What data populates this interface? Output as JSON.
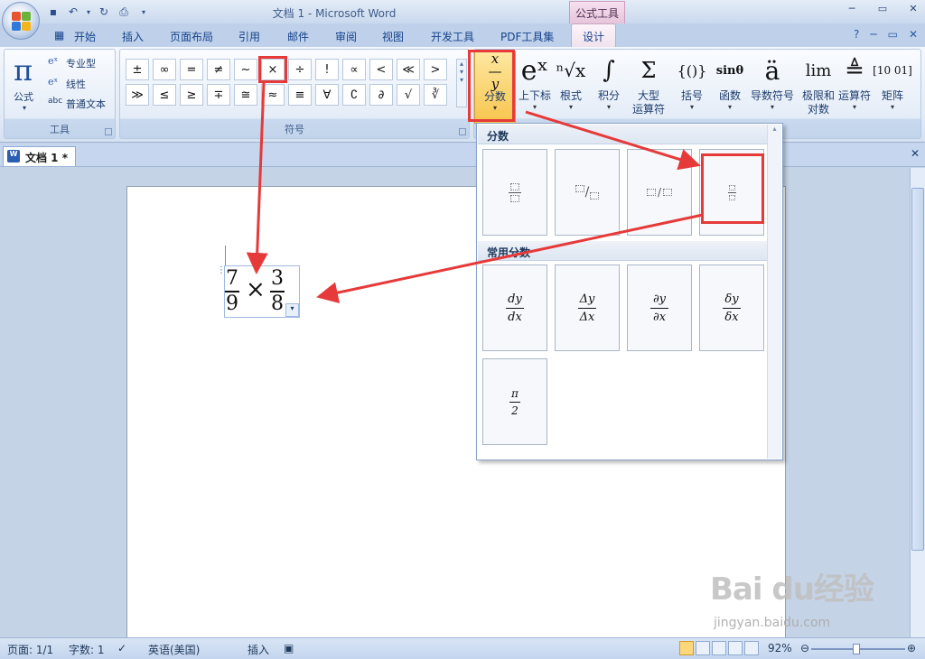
{
  "window": {
    "title": "文档 1 - Microsoft Word",
    "contextual_tab_group": "公式工具"
  },
  "tabs": [
    "开始",
    "插入",
    "页面布局",
    "引用",
    "邮件",
    "审阅",
    "视图",
    "开发工具",
    "PDF工具集",
    "设计"
  ],
  "ribbon": {
    "tools_group": {
      "label": "工具",
      "formula": "公式",
      "professional": "专业型",
      "linear": "线性",
      "normal_text": "普通文本",
      "normal_text_prefix": "abc"
    },
    "symbols_group": {
      "label": "符号",
      "row1": [
        "±",
        "∞",
        "=",
        "≠",
        "~",
        "×",
        "÷",
        "!",
        "∝",
        "<",
        "≪",
        ">"
      ],
      "row2": [
        "≫",
        "≤",
        "≥",
        "∓",
        "≅",
        "≈",
        "≡",
        "∀",
        "∁",
        "∂",
        "√",
        "∛"
      ]
    },
    "structures": [
      {
        "icon": "x/y",
        "label": "分数",
        "label2": ""
      },
      {
        "icon": "eˣ",
        "label": "上下标",
        "label2": ""
      },
      {
        "icon": "ⁿ√x",
        "label": "根式",
        "label2": ""
      },
      {
        "icon": "∫",
        "label": "积分",
        "label2": ""
      },
      {
        "icon": "Σ",
        "label": "大型",
        "label2": "运算符"
      },
      {
        "icon": "{()}",
        "label": "括号",
        "label2": ""
      },
      {
        "icon": "sinθ",
        "label": "函数",
        "label2": ""
      },
      {
        "icon": "ä",
        "label": "导数符号",
        "label2": ""
      },
      {
        "icon": "lim",
        "label": "极限和",
        "label2": "对数"
      },
      {
        "icon": "≜",
        "label": "运算符",
        "label2": ""
      },
      {
        "icon": "[10 01]",
        "label": "矩阵",
        "label2": ""
      }
    ]
  },
  "doc_tab": {
    "label": "文档 1 *"
  },
  "equation": {
    "frac1": {
      "num": "7",
      "den": "9"
    },
    "operator": "×",
    "frac2": {
      "num": "3",
      "den": "8"
    }
  },
  "gallery": {
    "section1": "分数",
    "section2": "常用分数",
    "common": [
      {
        "num": "dy",
        "den": "dx"
      },
      {
        "num": "Δy",
        "den": "Δx"
      },
      {
        "num": "∂y",
        "den": "∂x"
      },
      {
        "num": "δy",
        "den": "δx"
      },
      {
        "num": "π",
        "den": "2"
      }
    ]
  },
  "statusbar": {
    "page": "页面: 1/1",
    "words": "字数: 1",
    "language": "英语(美国)",
    "mode": "插入",
    "zoom": "92%"
  },
  "watermark": {
    "brand": "Bai du经验",
    "url": "jingyan.baidu.com"
  },
  "colors": {
    "highlight_red": "#e63a3a",
    "accent_orange": "#f8c54e",
    "ribbon_blue": "#c5d6ee"
  }
}
